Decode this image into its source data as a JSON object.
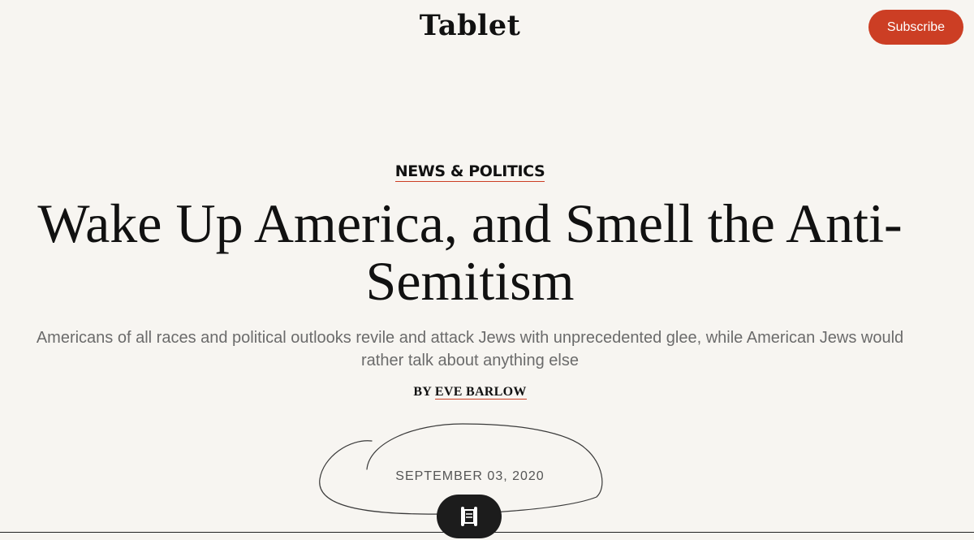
{
  "header": {
    "logo_text": "Tablet",
    "subscribe_label": "Subscribe"
  },
  "article": {
    "category": "NEWS & POLITICS",
    "headline_line1": "Wake Up America, and Smell the Anti-",
    "headline_line2": "Semitism",
    "dek_line1": "Americans of all races and political outlooks revile and attack Jews with unprecedented glee, while American Jews would",
    "dek_line2": "rather talk about anything else",
    "byline_prefix": "BY",
    "author": "EVE BARLOW",
    "date": "SEPTEMBER 03, 2020"
  },
  "scroll_control": {
    "icon": "torah-scroll-icon"
  },
  "colors": {
    "accent": "#cc3e24",
    "background": "#f7f5f1",
    "text": "#111111",
    "dek_text": "#6b6b6b",
    "pill": "#1c1c1c"
  }
}
